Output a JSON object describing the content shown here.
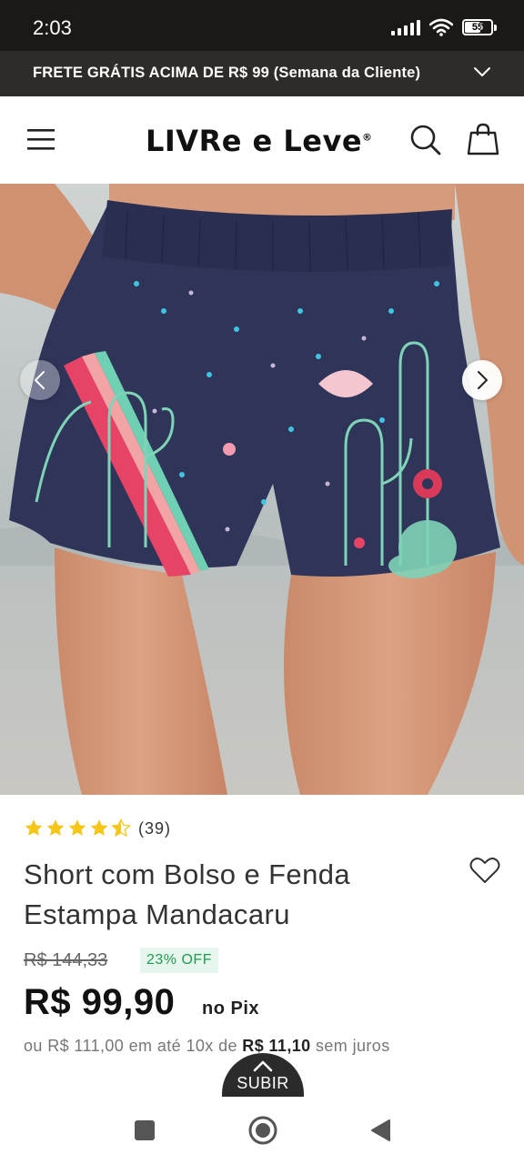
{
  "status_bar": {
    "time": "2:03",
    "battery": "55"
  },
  "promo": {
    "text": "FRETE GRÁTIS ACIMA DE R$ 99 (Semana da Cliente)"
  },
  "header": {
    "logo": "LIVRe e Leve",
    "logo_mark": "®"
  },
  "product": {
    "rating": 4.5,
    "rating_count": "(39)",
    "title": "Short com Bolso e Fenda Estampa Mandacaru",
    "old_price": "R$ 144,33",
    "discount": "23% OFF",
    "price": "R$ 99,90",
    "price_suffix": "no Pix",
    "installments_prefix": "ou R$ 111,00 em até 10x de",
    "installment_value": "R$ 11,10",
    "installments_suffix": "sem juros"
  },
  "scroll_top": {
    "label": "SUBIR"
  },
  "colors": {
    "status_bar": "#1c1815",
    "promo_bar": "#2e2b29",
    "star": "#f5c518",
    "discount_text": "#1f9a52",
    "discount_bg": "#e6f6ec"
  },
  "icons": [
    "menu-icon",
    "search-icon",
    "bag-icon",
    "heart-icon",
    "chevron-left-icon",
    "chevron-right-icon",
    "chevron-up-icon",
    "chevron-down-icon"
  ]
}
